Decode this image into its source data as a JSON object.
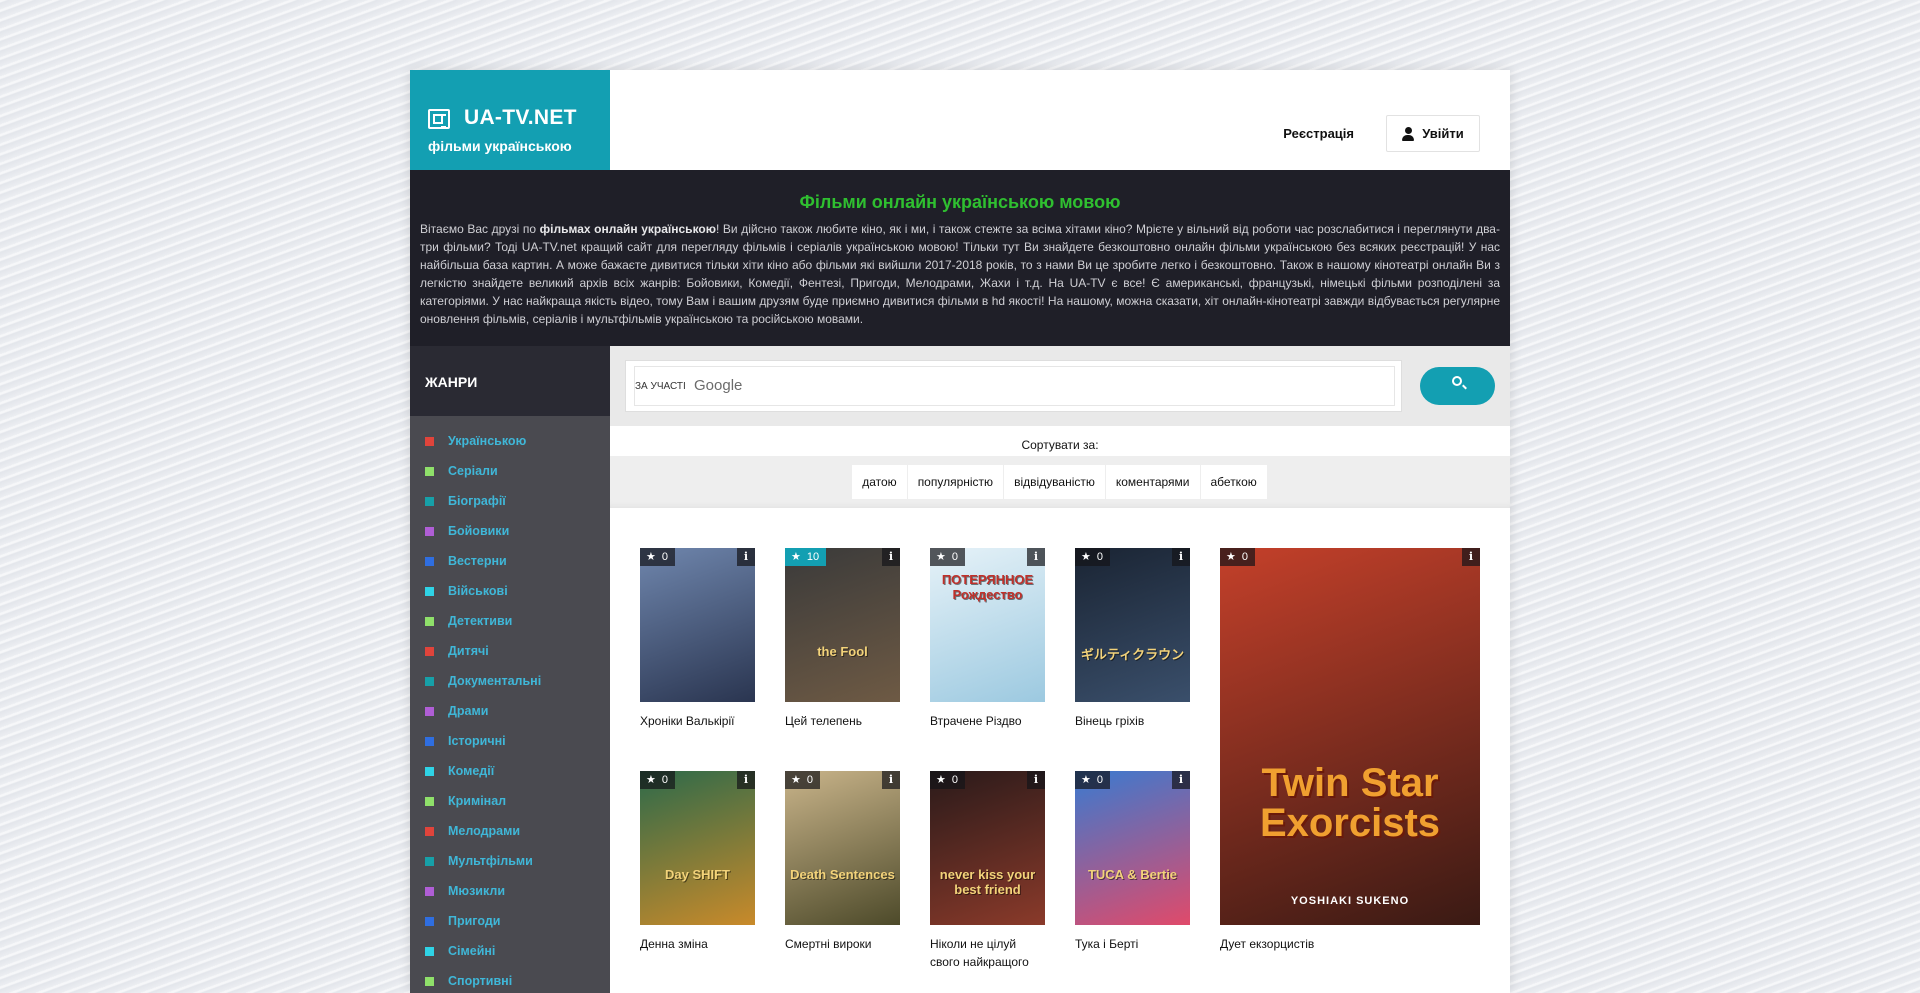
{
  "header": {
    "logo_title": "UA-TV.NET",
    "logo_sub": "фільми українською",
    "register": "Реєстрація",
    "login": "Увійти"
  },
  "intro": {
    "title": "Фільми онлайн українською мовою",
    "p_start": "Вітаємо Вас друзі по ",
    "p_bold": "фільмах онлайн українською",
    "p_rest": "! Ви дійсно також любите кіно, як і ми, і також стежте за всіма хітами кіно? Мрієте у вільний від роботи час розслабитися і переглянути два-три фільми? Тоді UA-TV.net кращий сайт для перегляду фільмів і серіалів українською мовою! Тільки тут Ви знайдете безкоштовно онлайн фільми українською без всяких реєстрацій! У нас найбільша база картин. А може бажаєте дивитися тільки хіти кіно або фільми які вийшли 2017-2018 років, то з нами Ви це зробите легко і безкоштовно. Також в нашому кінотеатрі онлайн Ви з легкістю знайдете великий архів всіх жанрів: Бойовики, Комедії, Фентезі, Пригоди, Мелодрами, Жахи і т.д. На UA-TV є все! Є американські, французькі, німецькі фільми розподілені за категоріями. У нас найкраща якість відео, тому Вам і вашим друзям буде приємно дивитися фільми в hd якості! На нашому, можна сказати, хіт онлайн-кінотеатрі завжди відбувається регулярне оновлення фільмів, серіалів і мультфільмів українською та російською мовами."
  },
  "sidebar": {
    "title": "ЖАНРИ",
    "genres": [
      {
        "label": "Українською",
        "color": "#e0443b"
      },
      {
        "label": "Серіали",
        "color": "#8fe06a"
      },
      {
        "label": "Біографії",
        "color": "#17a0a8"
      },
      {
        "label": "Бойовики",
        "color": "#b05ed6"
      },
      {
        "label": "Вестерни",
        "color": "#2f6ee0"
      },
      {
        "label": "Військові",
        "color": "#2fd3e6"
      },
      {
        "label": "Детективи",
        "color": "#8fe06a"
      },
      {
        "label": "Дитячі",
        "color": "#e0443b"
      },
      {
        "label": "Документальні",
        "color": "#17a0a8"
      },
      {
        "label": "Драми",
        "color": "#b05ed6"
      },
      {
        "label": "Історичні",
        "color": "#2f6ee0"
      },
      {
        "label": "Комедії",
        "color": "#2fd3e6"
      },
      {
        "label": "Кримінал",
        "color": "#8fe06a"
      },
      {
        "label": "Мелодрами",
        "color": "#e0443b"
      },
      {
        "label": "Мультфільми",
        "color": "#17a0a8"
      },
      {
        "label": "Мюзикли",
        "color": "#b05ed6"
      },
      {
        "label": "Пригоди",
        "color": "#2f6ee0"
      },
      {
        "label": "Сімейні",
        "color": "#2fd3e6"
      },
      {
        "label": "Спортивні",
        "color": "#8fe06a"
      }
    ]
  },
  "search": {
    "by_label": "ЗА УЧАСТІ",
    "brand": "Google",
    "icon": "search-icon"
  },
  "sort": {
    "title": "Сортувати за:",
    "options": [
      "датою",
      "популярністю",
      "відвідуваністю",
      "коментарями",
      "абеткою"
    ]
  },
  "movies": [
    {
      "title": "Хроніки Валькірії",
      "rating": "0",
      "highlight": false,
      "poster_colors": [
        "#6f86ad",
        "#2a3550"
      ],
      "poster_text": ""
    },
    {
      "title": "Цей телепень",
      "rating": "10",
      "highlight": true,
      "poster_colors": [
        "#3a3a3a",
        "#6e5a44"
      ],
      "poster_text": "the Fool"
    },
    {
      "title": "Втрачене Різдво",
      "rating": "0",
      "highlight": false,
      "poster_colors": [
        "#e6f2f8",
        "#9cc9e0"
      ],
      "poster_text": "ПОТЕРЯННОЕ Рождество"
    },
    {
      "title": "Вінець гріхів",
      "rating": "0",
      "highlight": false,
      "poster_colors": [
        "#1a2433",
        "#3a4f6b"
      ],
      "poster_text": "ギルティクラウン"
    },
    {
      "title": "Дует екзорцистів",
      "rating": "0",
      "highlight": false,
      "poster_colors": [
        "#c4402a",
        "#3a1a14"
      ],
      "poster_text": "Twin Star Exorcists",
      "poster_sub": "YOSHIAKI SUKENO"
    },
    {
      "title": "Денна зміна",
      "rating": "0",
      "highlight": false,
      "poster_colors": [
        "#2d6a4a",
        "#c98a2a"
      ],
      "poster_text": "Day SHIFT"
    },
    {
      "title": "Смертні вироки",
      "rating": "0",
      "highlight": false,
      "poster_colors": [
        "#c9b48a",
        "#4d4a2a"
      ],
      "poster_text": "Death Sentences"
    },
    {
      "title": "Ніколи не цілуй свого найкращого",
      "rating": "0",
      "highlight": false,
      "poster_colors": [
        "#2a1a1a",
        "#8a3a2a"
      ],
      "poster_text": "never kiss your best friend"
    },
    {
      "title": "Тука і Берті",
      "rating": "0",
      "highlight": false,
      "poster_colors": [
        "#3a7ad0",
        "#e04a6a"
      ],
      "poster_text": "TUCA & Bertie"
    }
  ]
}
